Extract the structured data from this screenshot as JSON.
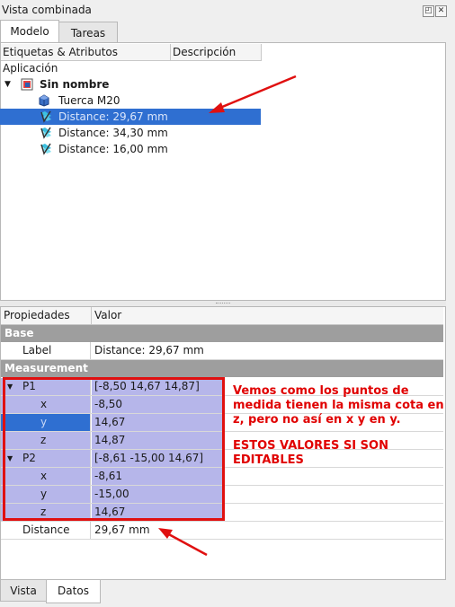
{
  "window": {
    "title": "Vista combinada",
    "float_icon": "float-icon",
    "close_icon": "close-icon"
  },
  "top_tabs": [
    {
      "label": "Modelo",
      "active": true
    },
    {
      "label": "Tareas",
      "active": false
    }
  ],
  "tree": {
    "columns": [
      "Etiquetas & Atributos",
      "Descripción"
    ],
    "root_label": "Aplicación",
    "document": {
      "label": "Sin nombre",
      "icon": "document-icon"
    },
    "items": [
      {
        "label": "Tuerca M20",
        "icon": "cube-icon",
        "selected": false
      },
      {
        "label": "Distance: 29,67 mm",
        "icon": "measure-distance-icon",
        "selected": true
      },
      {
        "label": "Distance: 34,30 mm",
        "icon": "measure-distance-icon",
        "selected": false
      },
      {
        "label": "Distance: 16,00 mm",
        "icon": "measure-distance-icon",
        "selected": false
      }
    ]
  },
  "properties": {
    "columns": [
      "Propiedades",
      "Valor"
    ],
    "groups": {
      "base": "Base",
      "measurement": "Measurement"
    },
    "label": {
      "name": "Label",
      "value": "Distance: 29,67 mm"
    },
    "p1": {
      "name": "P1",
      "value": "[-8,50 14,67 14,87]",
      "x": "-8,50",
      "y": "14,67",
      "z": "14,87"
    },
    "p2": {
      "name": "P2",
      "value": "[-8,61 -15,00 14,67]",
      "x": "-8,61",
      "y": "-15,00",
      "z": "14,67"
    },
    "axis_names": {
      "x": "x",
      "y": "y",
      "z": "z"
    },
    "distance": {
      "name": "Distance",
      "value": "29,67 mm"
    }
  },
  "annotations": {
    "note1": "Vemos como los puntos de medida tienen la misma cota en z, pero no así en x y en y.",
    "note2": "ESTOS VALORES SI SON EDITABLES",
    "color": "#e00000"
  },
  "bottom_tabs": [
    {
      "label": "Vista",
      "active": false
    },
    {
      "label": "Datos",
      "active": true
    }
  ],
  "colors": {
    "selection": "#2f6fd1",
    "highlight": "#b6b6ea",
    "group_header": "#9e9e9e"
  }
}
